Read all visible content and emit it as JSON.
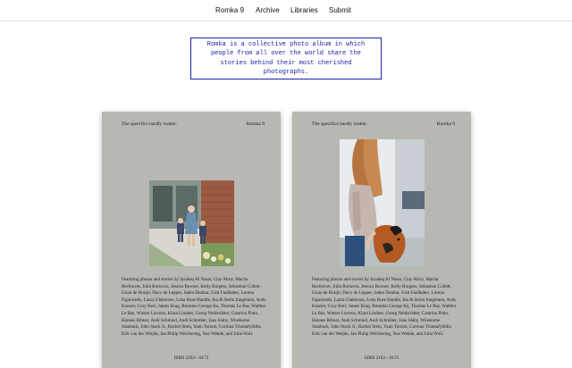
{
  "nav": {
    "items": [
      "Romka 9",
      "Archive",
      "Libraries",
      "Submit"
    ]
  },
  "intro": {
    "text": "Romka is a collective photo album in which people from all over the world share the stories behind their most cherished photographs."
  },
  "books": [
    {
      "header_left": "The specifics hardly matter.",
      "header_right": "Romka 9",
      "credits": "Featuring photos and stories by Izzabaq Al Nasar, Clay Alroy, Macha Bechtover, Julia Borisova, Jessica Bowser, Kelly Burgess, Sebastian Collett, Gioia de Bruijn, Davy de Lepper, Jaden Dunbar, Gritt Faulhaber, Lorena Figueiredo, Laura Glaberson, Lena Rose Handle, Ina & Stella Jungmann, Andy Kassier, Cory Kerr, James King, Brendon George Ko, Thomas Le Bas, Walther Le Bas, Wiener Lievens, Klara Lindner, Georg Nehlsrödter, Catarina Pinto, Hannes Ribner, Andi Schmied, Andi Schreiber, Jana Slaby, Windsome Stanback, John Stack Jr., Rachel Stein, Yann Tortain, Corinna Triantafyllidis, Erik van der Weijde, Jan Philip Welchering, Nao Wehde, and Julia Woll.",
      "isbn": "ISBN 2192—9173",
      "photo_description_icon": "family-portrait-photo"
    },
    {
      "header_left": "The specifics hardly matter.",
      "header_right": "Romka 9",
      "credits": "Featuring photos and stories by Izzabaq Al Nasar, Clay Alroy, Macha Bechtover, Julia Borisova, Jessica Bowser, Kelly Burgess, Sebastian Collett, Gioia de Bruijn, Davy de Lepper, Jaden Dunbar, Gritt Faulhaber, Lorena Figueiredo, Laura Glaberson, Lena Rose Handle, Ina & Stella Jungmann, Andy Kassier, Cory Kerr, James King, Brendon George Ko, Thomas Le Bas, Walther Le Bas, Wiener Lievens, Klara Lindner, Georg Nehlsrödter, Catarina Pinto, Hannes Ribner, Andi Schmied, Andi Schreiber, Jana Slaby, Windsome Stanback, John Stack Jr., Rachel Stein, Yann Tortain, Corinna Triantafyllidis, Erik van der Weijde, Jan Philip Welchering, Nao Wehde, and Julia Woll.",
      "isbn": "ISBN 2192—9173",
      "photo_description_icon": "woman-with-dog-photo"
    }
  ],
  "colors": {
    "accent": "#1d22a8",
    "book_cover": "#b7b8b1"
  }
}
